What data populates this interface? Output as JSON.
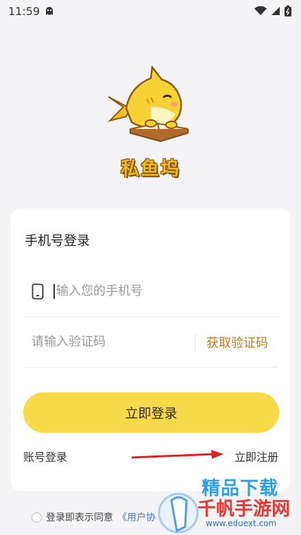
{
  "status_bar": {
    "time": "11:59"
  },
  "app": {
    "name": "私鱼坞"
  },
  "login": {
    "title": "手机号登录",
    "phone_placeholder": "输入您的手机号",
    "code_placeholder": "请输入验证码",
    "get_code_label": "获取验证码",
    "login_button_label": "立即登录",
    "account_login_label": "账号登录",
    "register_label": "立即注册"
  },
  "agreement": {
    "prefix": "登录即表示同意",
    "user_agreement": "《用户协"
  },
  "watermark": {
    "line1": "精品下载",
    "line2": "千帆手游网",
    "url": "www.eduext.com"
  },
  "colors": {
    "accent": "#f8d94a",
    "link_orange": "#c57b1b",
    "link_blue": "#3a7bd5",
    "arrow_red": "#e02020"
  },
  "icons": [
    "ghost-notification-icon",
    "wifi-icon",
    "signal-icon",
    "battery-icon",
    "phone-icon"
  ]
}
